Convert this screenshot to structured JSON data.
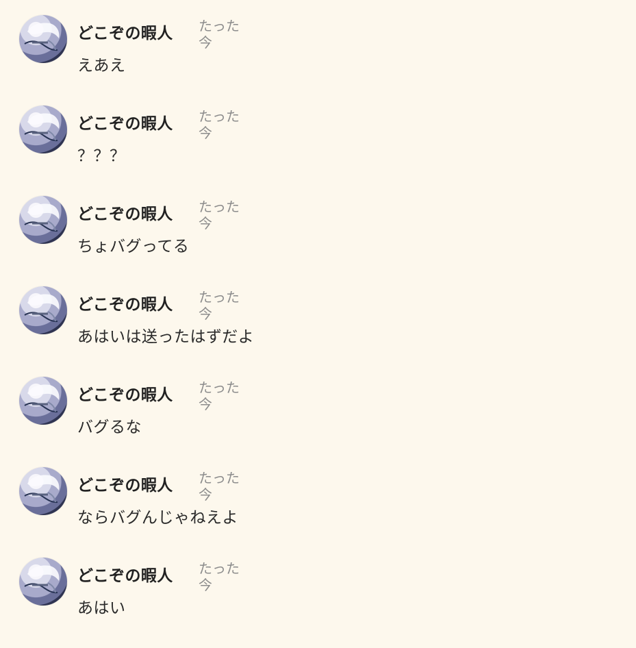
{
  "messages": [
    {
      "author": "どこぞの暇人",
      "timestamp": "たった今",
      "text": "えあえ"
    },
    {
      "author": "どこぞの暇人",
      "timestamp": "たった今",
      "text": "？？？"
    },
    {
      "author": "どこぞの暇人",
      "timestamp": "たった今",
      "text": "ちょバグってる"
    },
    {
      "author": "どこぞの暇人",
      "timestamp": "たった今",
      "text": "あはいは送ったはずだよ"
    },
    {
      "author": "どこぞの暇人",
      "timestamp": "たった今",
      "text": "バグるな"
    },
    {
      "author": "どこぞの暇人",
      "timestamp": "たった今",
      "text": "ならバグんじゃねえよ"
    },
    {
      "author": "どこぞの暇人",
      "timestamp": "たった今",
      "text": "あはい"
    }
  ],
  "avatar": {
    "icon": "user-avatar-icon",
    "colors": [
      "#f7f6fb",
      "#d8d9ea",
      "#a8aacb",
      "#6a6f9a",
      "#2f3452"
    ]
  },
  "colors": {
    "background": "#fdf8ed",
    "author": "#222222",
    "timestamp": "#8c8c8c",
    "message": "#2a2a2a"
  }
}
